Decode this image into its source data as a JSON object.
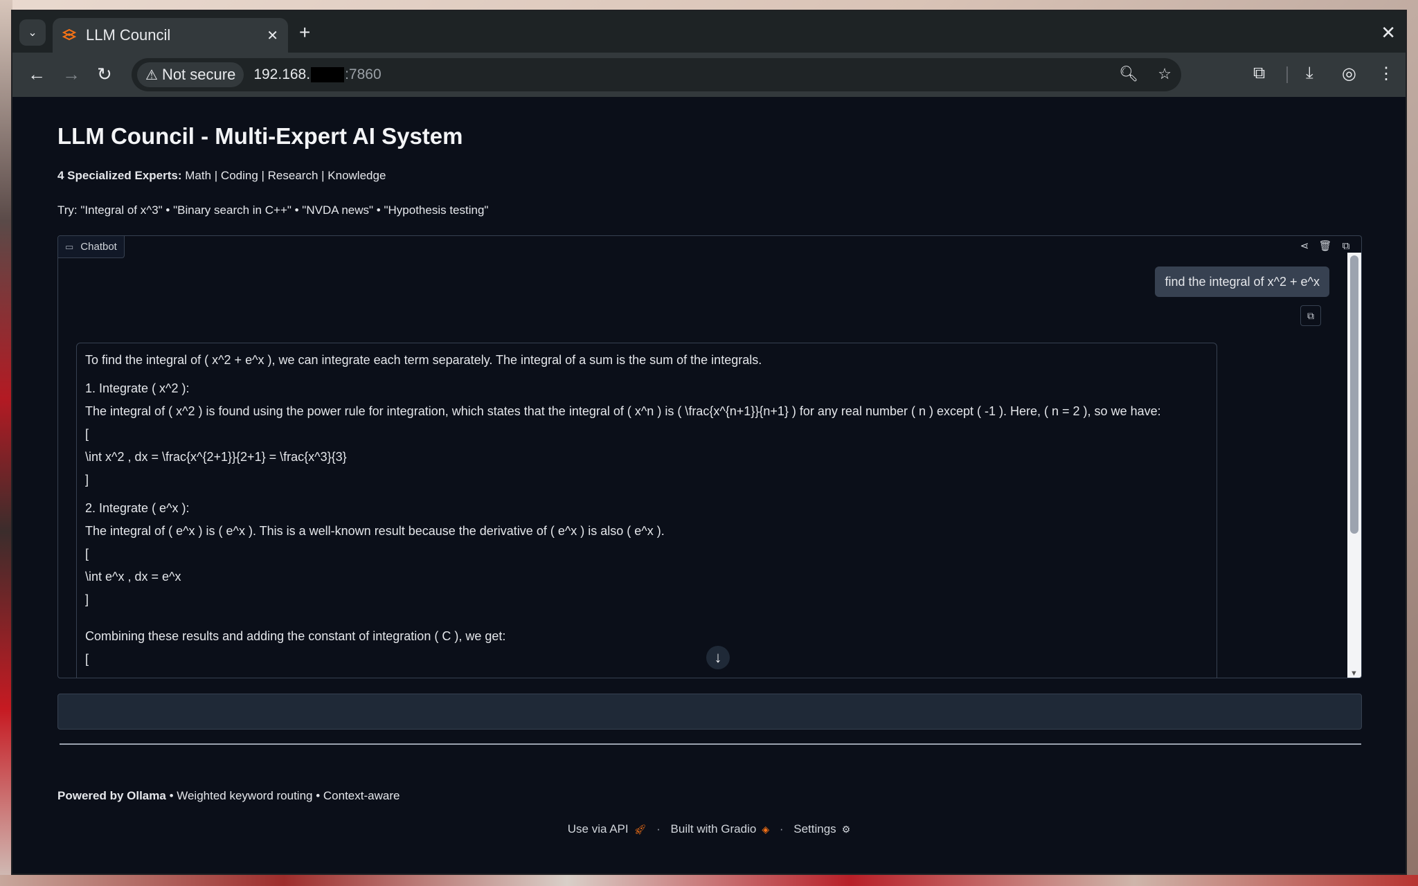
{
  "browser": {
    "tab_title": "LLM Council",
    "new_tab": "+",
    "security_label": "Not secure",
    "url_prefix": "192.168.",
    "url_suffix": ":7860"
  },
  "page": {
    "title": "LLM Council - Multi-Expert AI System",
    "experts_label": "4 Specialized Experts:",
    "experts_list": "Math | Coding | Research | Knowledge",
    "try_text": "Try: \"Integral of x^3\" • \"Binary search in C++\" • \"NVDA news\" • \"Hypothesis testing\""
  },
  "chatbot": {
    "label": "Chatbot",
    "user_message": "find the integral of x^2 + e^x",
    "bot_lines": {
      "l1": "To find the integral of ( x^2 + e^x ), we can integrate each term separately. The integral of a sum is the sum of the integrals.",
      "l2": "1. Integrate ( x^2 ):",
      "l3": "The integral of ( x^2 ) is found using the power rule for integration, which states that the integral of ( x^n ) is ( \\frac{x^{n+1}}{n+1} ) for any real number ( n ) except ( -1 ). Here, ( n = 2 ), so we have:",
      "l4": "[",
      "l5": "\\int x^2 , dx = \\frac{x^{2+1}}{2+1} = \\frac{x^3}{3}",
      "l6": "]",
      "l7": "2. Integrate ( e^x ):",
      "l8": "The integral of ( e^x ) is ( e^x ). This is a well-known result because the derivative of ( e^x ) is also ( e^x ).",
      "l9": "[",
      "l10": "\\int e^x , dx = e^x",
      "l11": "]",
      "l12": "Combining these results and adding the constant of integration ( C ), we get:",
      "l13": "["
    }
  },
  "input": {
    "value": ""
  },
  "footer": {
    "powered_by": "Powered by Ollama",
    "powered_rest": " • Weighted keyword routing • Context-aware",
    "use_api": "Use via API",
    "built_with": "Built with Gradio",
    "settings": "Settings"
  },
  "colors": {
    "accent_orange": "#f97316",
    "page_bg": "#0b0f19"
  }
}
